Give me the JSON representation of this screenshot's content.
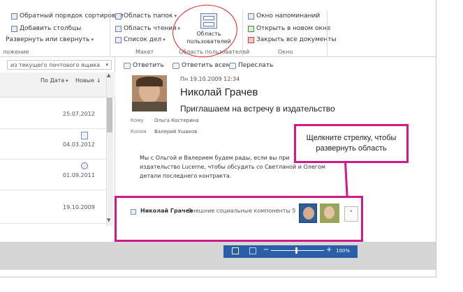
{
  "ribbon": {
    "col1": [
      "Обратный порядок сортировки",
      "Добавить столбцы",
      "Развернуть или свернуть"
    ],
    "col1_group": "ложение",
    "col2": [
      "Область папок",
      "Область чтения",
      "Список дел"
    ],
    "col2_group": "Макет",
    "people_pane": "Область пользователей",
    "people_group": "Область пользователей",
    "col4": [
      "Окно напоминаний",
      "Открыть в новом окне",
      "Закрыть все документы"
    ],
    "col4_group": "Окно"
  },
  "mail_list": {
    "search_scope": "из текущего почтового ящика",
    "sort_by": "По Дата",
    "sort_order": "Новые",
    "dates": [
      "25.07.2012",
      "04.03.2012",
      "01.09.2011",
      "19.10.2009"
    ]
  },
  "reading": {
    "actions": [
      "Ответить",
      "Ответить всем",
      "Переслать"
    ],
    "datetime": "Пн 19.10.2009 12:34",
    "sender": "Николай Грачев",
    "subject": "Приглашаем на встречу в издательство",
    "to_label": "Кому",
    "to_value": "Ольга Костерина",
    "cc_label": "Копия",
    "cc_value": "Валерий Ушаков",
    "body_lines": [
      "Мы с Ольгой и Валерием будем рады, если вы при",
      "издательство Lucerne, чтобы обсудить со Светланой и Олегом",
      "детали последнего контракта."
    ]
  },
  "people_bar": {
    "name": "Николай Грачев",
    "info": "Внешние социальные компоненты 5"
  },
  "callout": "Щелкните стрелку, чтобы развернуть область",
  "status": {
    "zoom": "100%"
  }
}
